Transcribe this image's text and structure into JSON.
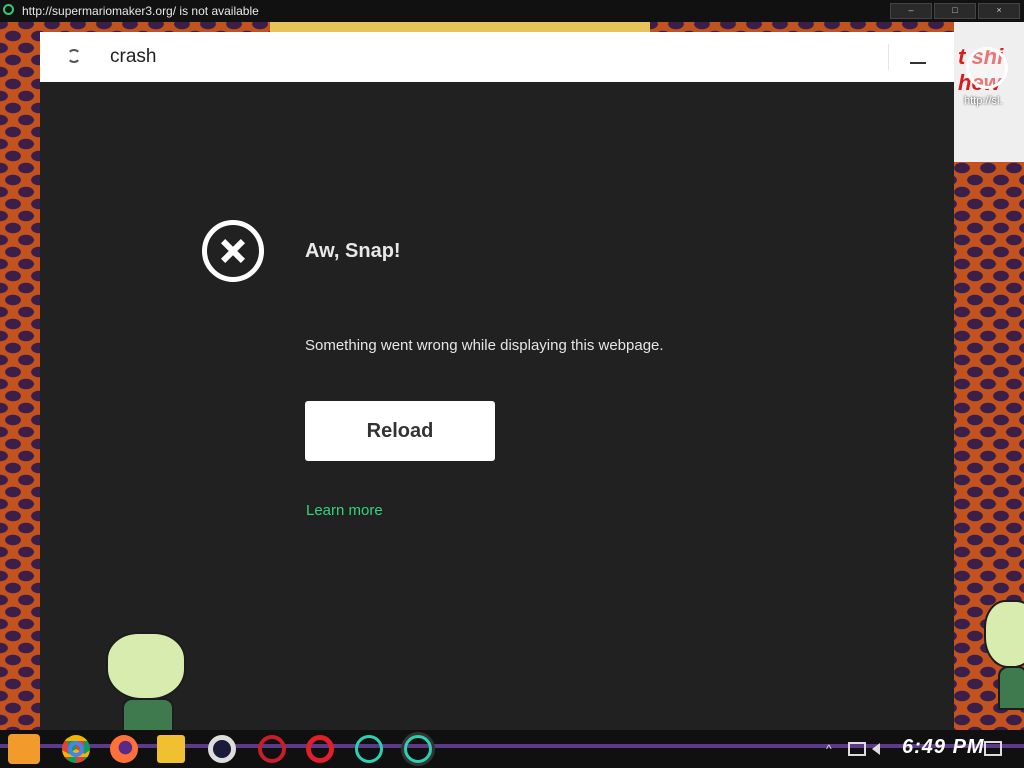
{
  "window": {
    "title_url": "http://supermariomaker3.org/",
    "title_status": "is not available",
    "btn_minimize": "–",
    "btn_maximize": "□",
    "btn_close": "×"
  },
  "side_widget": {
    "url": "http://sl."
  },
  "browser": {
    "address": "crash",
    "error_title": "Aw, Snap!",
    "error_message": "Something went wrong while displaying this webpage.",
    "reload_label": "Reload",
    "learn_more_label": "Learn more"
  },
  "taskbar": {
    "icons": [
      "chrome-icon",
      "firefox-icon",
      "file-explorer-icon",
      "opera-icon",
      "opera-red-icon",
      "opera-red-active-icon",
      "opera-gx-icon",
      "opera-gx-active-icon"
    ],
    "tray_chevron": "^",
    "clock": "6:49 PM"
  },
  "colors": {
    "accent_link": "#35d37a",
    "browser_bg": "#212121"
  }
}
